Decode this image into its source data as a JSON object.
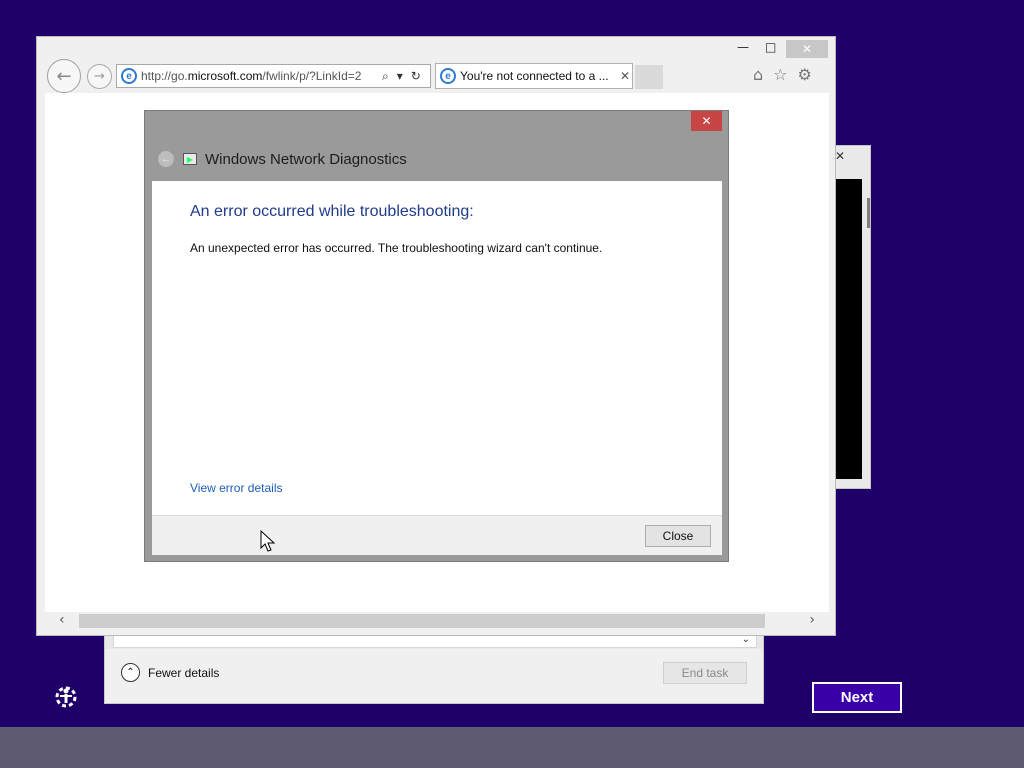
{
  "browser": {
    "url_prefix": "http://go.",
    "url_domain": "microsoft.com",
    "url_suffix": "/fwlink/p/?LinkId=2",
    "tab_title": "You're not connected to a ...",
    "window_controls": {
      "minimize": "—",
      "maximize": "□",
      "close": "✕"
    },
    "tool_icons": [
      "home-icon",
      "star-icon",
      "gear-icon"
    ]
  },
  "dialog": {
    "title": "Windows Network Diagnostics",
    "heading": "An error occurred while troubleshooting:",
    "message": "An unexpected error has occurred. The troubleshooting wizard can't continue.",
    "link": "View error details",
    "close_button": "Close"
  },
  "task_manager": {
    "fewer_details": "Fewer details",
    "end_task": "End task"
  },
  "setup": {
    "next_button": "Next"
  },
  "colors": {
    "background": "#1f0068",
    "accent": "#3a00a8",
    "dialog_heading": "#1f3b8a",
    "link": "#1c5fb5",
    "close_red": "#c74545"
  }
}
